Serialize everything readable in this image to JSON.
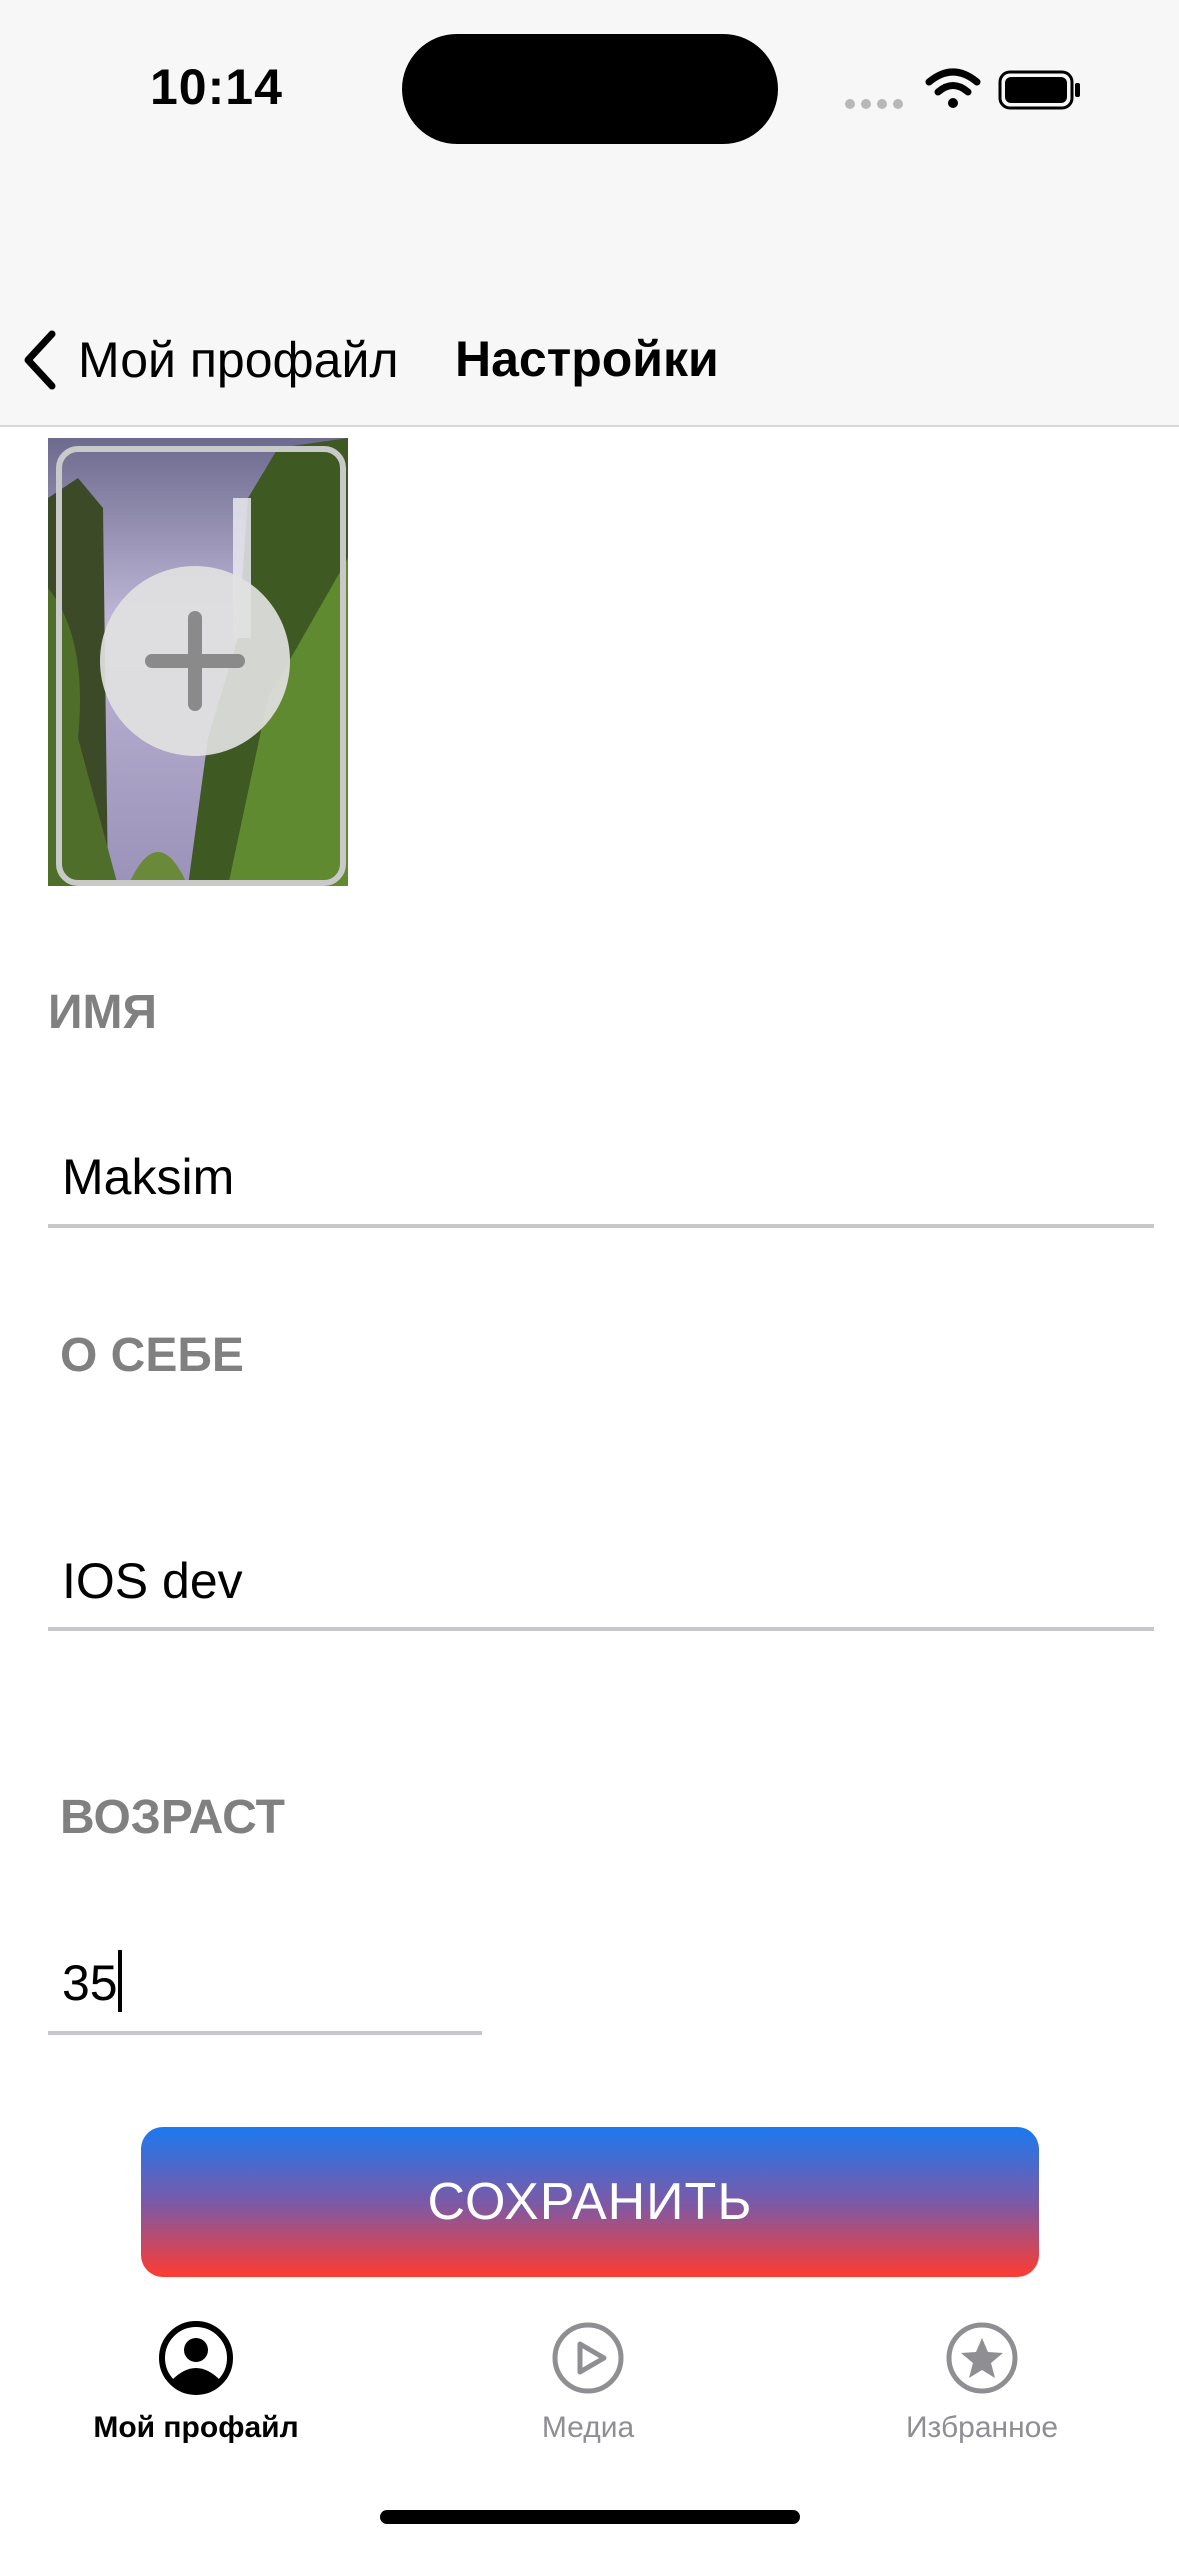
{
  "status_bar": {
    "time": "10:14"
  },
  "nav": {
    "back_label": "Мой профайл",
    "title": "Настройки"
  },
  "form": {
    "name_label": "ИМЯ",
    "name_value": "Maksim",
    "about_label": "О СЕБЕ",
    "about_value": "IOS dev",
    "age_label": "ВОЗРАСТ",
    "age_value": "35"
  },
  "save_button": "СОХРАНИТЬ",
  "tabs": [
    {
      "label": "Мой профайл",
      "icon": "person-circle-icon",
      "active": true
    },
    {
      "label": "Медиа",
      "icon": "play-circle-icon",
      "active": false
    },
    {
      "label": "Избранное",
      "icon": "star-circle-icon",
      "active": false
    }
  ],
  "colors": {
    "active_tab": "#000000",
    "inactive_tab": "#8e8e93",
    "button_top": "#1b79f0",
    "button_bottom": "#ff3b30"
  }
}
